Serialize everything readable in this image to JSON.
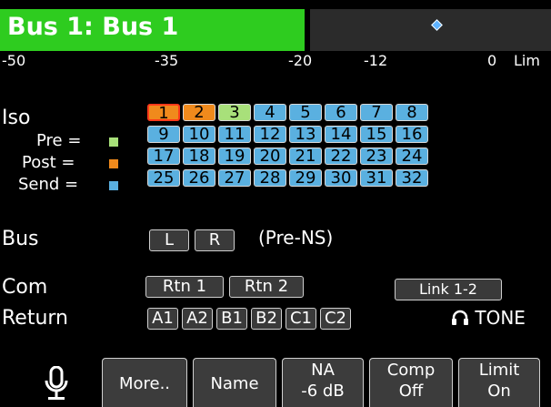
{
  "header": {
    "title": "Bus 1: Bus 1"
  },
  "meter": {
    "scale": [
      "-50",
      "-35",
      "-20",
      "-12",
      "0",
      "Lim"
    ]
  },
  "iso": {
    "label": "Iso",
    "legend": [
      {
        "label": "Pre =",
        "color": "#a8e07a"
      },
      {
        "label": "Post =",
        "color": "#f08a1c"
      },
      {
        "label": "Send =",
        "color": "#5ab0e0"
      }
    ],
    "channels": [
      {
        "n": "1",
        "state": "post",
        "selected": true
      },
      {
        "n": "2",
        "state": "post"
      },
      {
        "n": "3",
        "state": "pre"
      },
      {
        "n": "4",
        "state": "send"
      },
      {
        "n": "5",
        "state": "send"
      },
      {
        "n": "6",
        "state": "send"
      },
      {
        "n": "7",
        "state": "send"
      },
      {
        "n": "8",
        "state": "send"
      },
      {
        "n": "9",
        "state": "send"
      },
      {
        "n": "10",
        "state": "send"
      },
      {
        "n": "11",
        "state": "send"
      },
      {
        "n": "12",
        "state": "send"
      },
      {
        "n": "13",
        "state": "send"
      },
      {
        "n": "14",
        "state": "send"
      },
      {
        "n": "15",
        "state": "send"
      },
      {
        "n": "16",
        "state": "send"
      },
      {
        "n": "17",
        "state": "send"
      },
      {
        "n": "18",
        "state": "send"
      },
      {
        "n": "19",
        "state": "send"
      },
      {
        "n": "20",
        "state": "send"
      },
      {
        "n": "21",
        "state": "send"
      },
      {
        "n": "22",
        "state": "send"
      },
      {
        "n": "23",
        "state": "send"
      },
      {
        "n": "24",
        "state": "send"
      },
      {
        "n": "25",
        "state": "send"
      },
      {
        "n": "26",
        "state": "send"
      },
      {
        "n": "27",
        "state": "send"
      },
      {
        "n": "28",
        "state": "send"
      },
      {
        "n": "29",
        "state": "send"
      },
      {
        "n": "30",
        "state": "send"
      },
      {
        "n": "31",
        "state": "send"
      },
      {
        "n": "32",
        "state": "send"
      }
    ],
    "state_colors": {
      "pre": "#a8e07a",
      "post": "#f08a1c",
      "send": "#5ab0e0"
    }
  },
  "bus": {
    "label": "Bus",
    "left": "L",
    "right": "R",
    "note": "(Pre-NS)"
  },
  "com": {
    "label": "Com",
    "rtn1": "Rtn 1",
    "rtn2": "Rtn 2",
    "link": "Link 1-2"
  },
  "return": {
    "label": "Return",
    "buttons": [
      "A1",
      "A2",
      "B1",
      "B2",
      "C1",
      "C2"
    ],
    "tone": "TONE"
  },
  "softkeys": {
    "more": "More..",
    "name": "Name",
    "na": {
      "line1": "NA",
      "line2": "-6 dB"
    },
    "comp": {
      "line1": "Comp",
      "line2": "Off"
    },
    "limit": {
      "line1": "Limit",
      "line2": "On"
    }
  }
}
